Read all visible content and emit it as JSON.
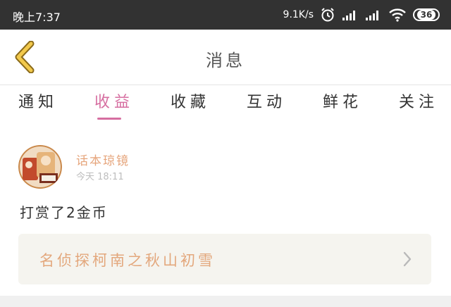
{
  "status_bar": {
    "time": "晚上7:37",
    "network_speed": "9.1K/s",
    "battery": "36",
    "icons": [
      "alarm-icon",
      "signal-icon",
      "signal-icon",
      "wifi-icon",
      "battery-icon"
    ]
  },
  "header": {
    "title": "消息"
  },
  "tabs": [
    {
      "label": "通知",
      "active": false
    },
    {
      "label": "收益",
      "active": true
    },
    {
      "label": "收藏",
      "active": false
    },
    {
      "label": "互动",
      "active": false
    },
    {
      "label": "鲜花",
      "active": false
    },
    {
      "label": "关注",
      "active": false
    }
  ],
  "message": {
    "author": "话本琼镜",
    "time": "今天 18:11",
    "text": "打赏了2金币",
    "book_title": "名侦探柯南之秋山初雪"
  },
  "colors": {
    "status_bar_bg": "#323232",
    "accent": "#d66ea0",
    "back_arrow": "#f2c94c",
    "author": "#e6a57c",
    "card_bg": "#f5f4ef"
  }
}
